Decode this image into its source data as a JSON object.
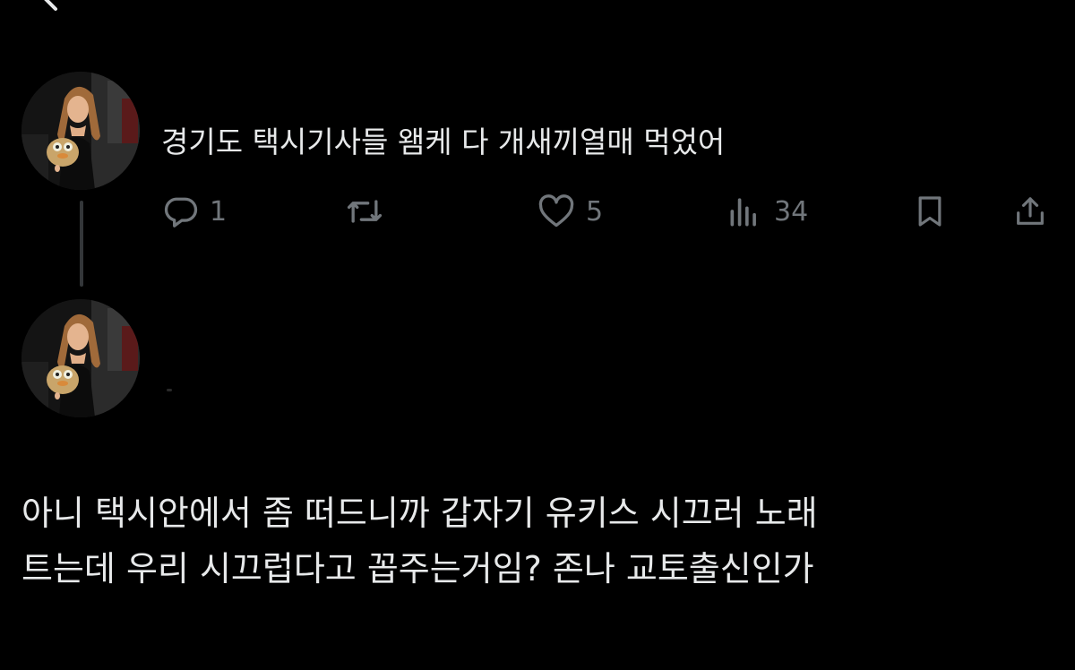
{
  "header": {
    "back_icon": "arrow-left-icon"
  },
  "parent_tweet": {
    "avatar": "user-avatar-photo",
    "text": "경기도 택시기사들 왬케 다 개새끼열매 먹었어",
    "actions": {
      "reply": {
        "icon": "reply-icon",
        "count": "1"
      },
      "retweet": {
        "icon": "retweet-icon",
        "count": ""
      },
      "like": {
        "icon": "heart-icon",
        "count": "5"
      },
      "views": {
        "icon": "views-icon",
        "count": "34"
      },
      "bookmark": {
        "icon": "bookmark-icon"
      },
      "share": {
        "icon": "share-icon"
      }
    }
  },
  "reply_tweet": {
    "avatar": "user-avatar-photo",
    "text_lines": [
      "아니 택시안에서 좀 떠드니까 갑자기 유키스 시끄러 노래",
      "트는데 우리 시끄럽다고 꼽주는거임? 존나 교토출신인가"
    ]
  },
  "colors": {
    "background": "#000000",
    "text": "#e7e9ea",
    "icon_gray": "#71767b",
    "thread_line": "#333639"
  }
}
